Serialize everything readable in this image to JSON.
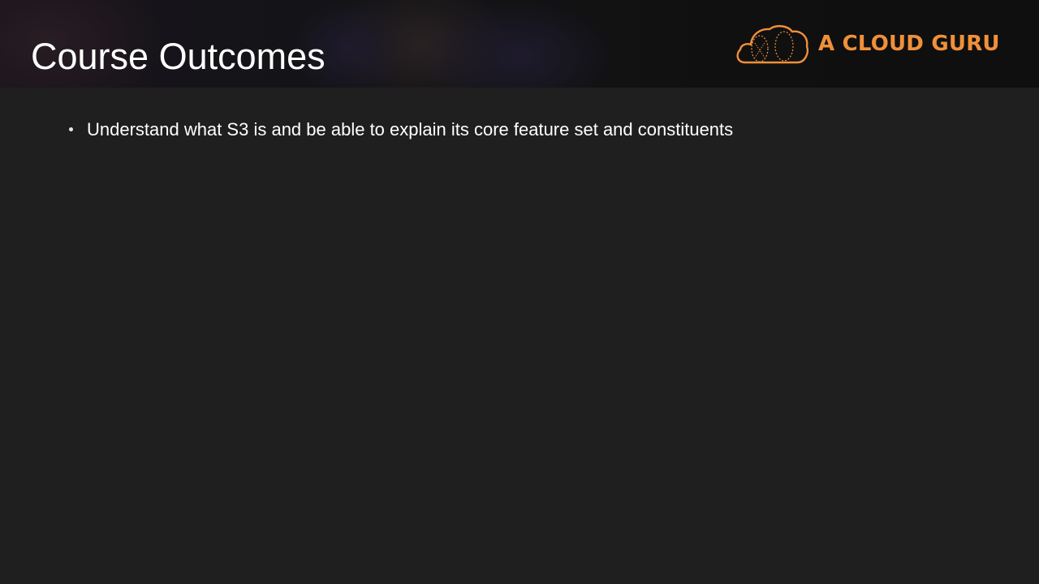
{
  "slide": {
    "title": "Course Outcomes",
    "logo": {
      "text": "A CLOUD GURU",
      "icon": "cloud-logo-icon",
      "color": "#f0903a"
    },
    "bullets": [
      "Understand what S3 is and be able to explain its core feature set and constituents"
    ]
  },
  "colors": {
    "background": "#1f1f1f",
    "header_background": "#161616",
    "title_text": "#ffffff",
    "body_text": "#ffffff",
    "brand_accent": "#f0903a"
  }
}
